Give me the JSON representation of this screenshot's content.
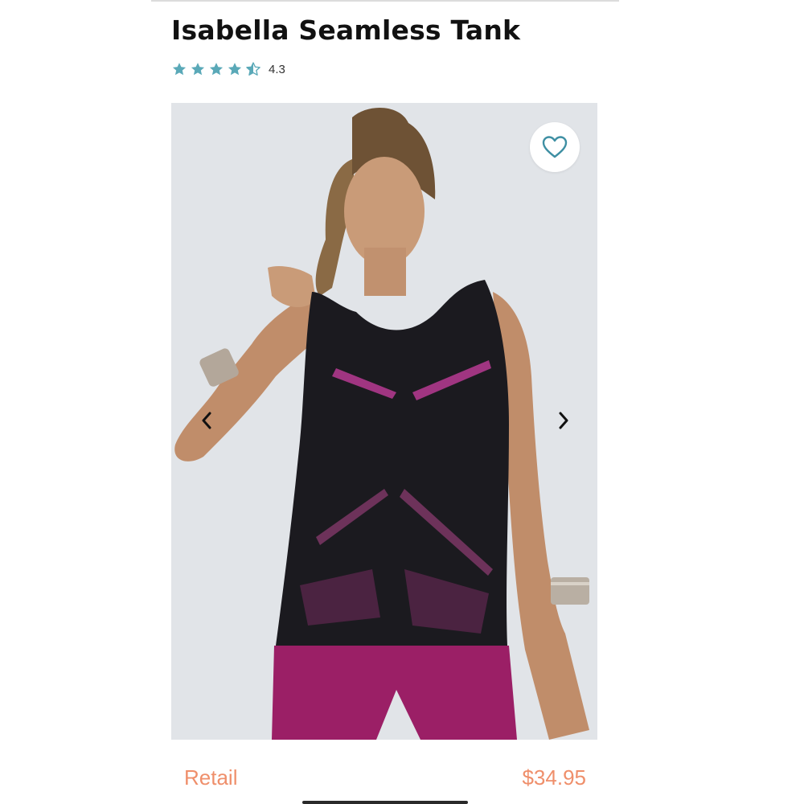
{
  "product": {
    "title": "Isabella Seamless Tank",
    "rating": {
      "value": "4.3",
      "stars_filled": 4,
      "stars_half": 1,
      "stars_total": 5,
      "star_color": "#5aa9b8"
    }
  },
  "gallery": {
    "image_label": "Model wearing black seamless tank with mesh cutouts and magenta leggings",
    "favorite_icon": "heart-outline-icon",
    "prev_icon": "chevron-left-icon",
    "next_icon": "chevron-right-icon",
    "accent_color": "#3e8fa3"
  },
  "pricing": {
    "retail_label": "Retail",
    "price": "$34.95",
    "color": "#ef8f6b"
  }
}
